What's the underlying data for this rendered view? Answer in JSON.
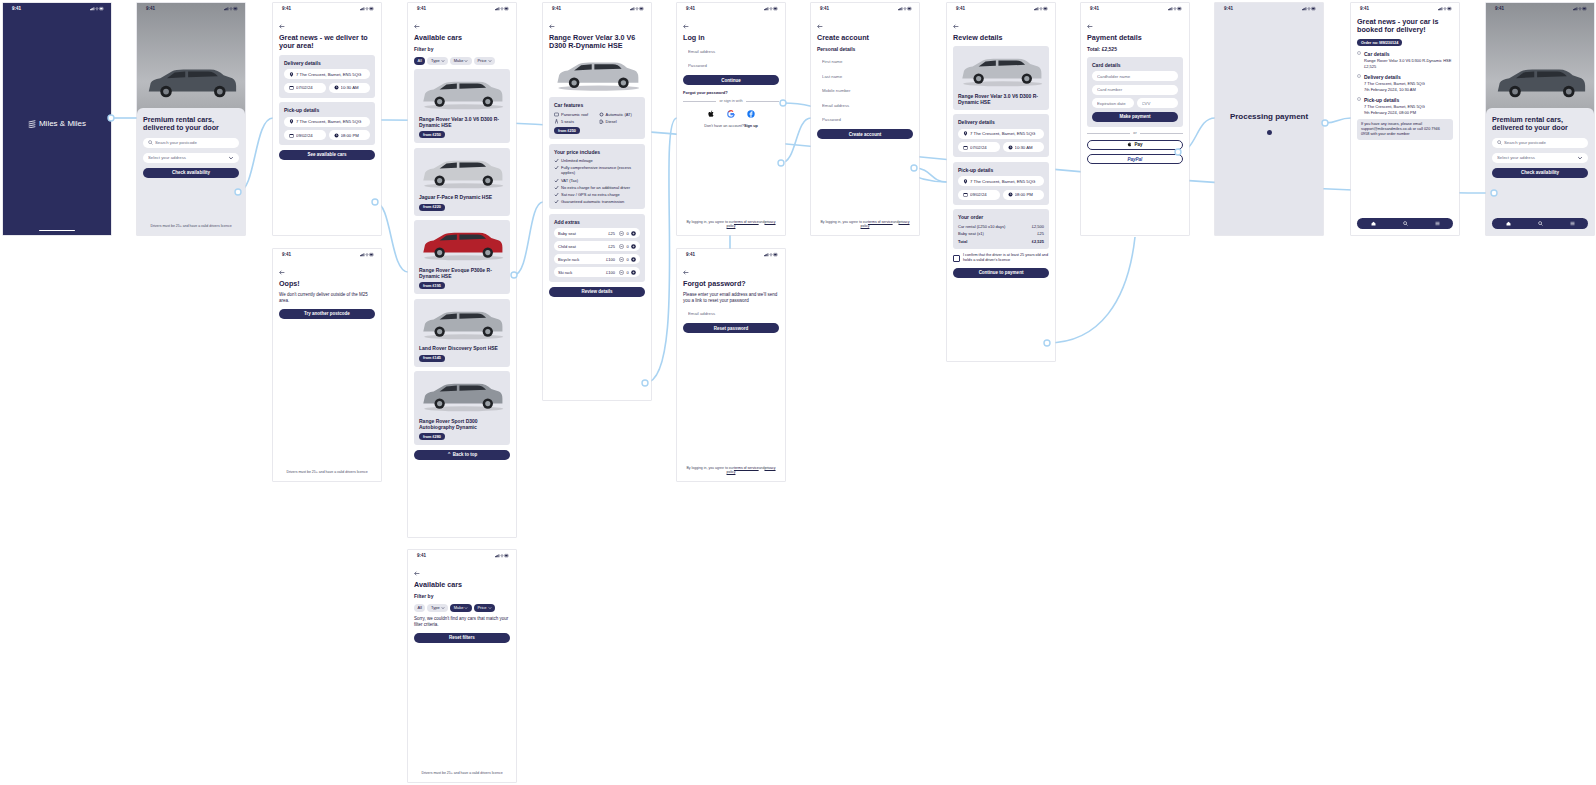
{
  "screens": [
    {
      "kind": "splash",
      "time": "9:41",
      "blocks": [
        {
          "kind": "logo",
          "text": "Miles & Miles"
        }
      ]
    },
    {
      "kind": "hero",
      "time": "9:41",
      "blocks": [
        {
          "kind": "photo"
        },
        {
          "kind": "sheet",
          "blocks": [
            {
              "kind": "title",
              "text": "Premium rental cars, delivered to your door"
            },
            {
              "kind": "field",
              "type": "search",
              "text": "Search your postcode"
            },
            {
              "kind": "field",
              "type": "select",
              "text": "Select your address"
            },
            {
              "kind": "button",
              "variant": "primary",
              "text": "Check availability"
            },
            {
              "kind": "spacer"
            },
            {
              "kind": "footnote",
              "text": "Drivers must be 25+ and have a valid drivers licence"
            }
          ]
        }
      ]
    },
    {
      "kind": "page",
      "time": "9:41",
      "blocks": [
        {
          "kind": "back"
        },
        {
          "kind": "title",
          "text": "Great news - we deliver to your area!"
        },
        {
          "kind": "card",
          "title": "Delivery details",
          "blocks": [
            {
              "kind": "field",
              "type": "address",
              "text": "7 The Crescent, Barnet, EN5 5QG"
            },
            {
              "kind": "fieldpair",
              "items": [
                {
                  "type": "date",
                  "text": "07/02/24"
                },
                {
                  "type": "time",
                  "text": "10:30 AM"
                }
              ]
            }
          ]
        },
        {
          "kind": "card",
          "title": "Pick-up details",
          "blocks": [
            {
              "kind": "field",
              "type": "address",
              "text": "7 The Crescent, Barnet, EN5 5QG"
            },
            {
              "kind": "fieldpair",
              "items": [
                {
                  "type": "date",
                  "text": "09/02/24"
                },
                {
                  "type": "time",
                  "text": "08:00 PM"
                }
              ]
            }
          ]
        },
        {
          "kind": "button",
          "variant": "primary",
          "text": "See available cars"
        }
      ]
    },
    {
      "kind": "page",
      "time": "9:41",
      "blocks": [
        {
          "kind": "back"
        },
        {
          "kind": "title",
          "text": "Oops!"
        },
        {
          "kind": "text",
          "text": "We don't currently deliver outside of the M25 area."
        },
        {
          "kind": "button",
          "variant": "primary",
          "text": "Try another postcode"
        },
        {
          "kind": "spacer"
        },
        {
          "kind": "footnote",
          "text": "Drivers must be 25+ and have a valid drivers licence"
        }
      ]
    },
    {
      "kind": "page",
      "time": "9:41",
      "blocks": [
        {
          "kind": "back"
        },
        {
          "kind": "title",
          "text": "Available cars"
        },
        {
          "kind": "heading",
          "text": "Filter by"
        },
        {
          "kind": "chips",
          "items": [
            {
              "text": "All",
              "selected": true,
              "dropdown": false
            },
            {
              "text": "Type",
              "selected": false,
              "dropdown": true
            },
            {
              "text": "Make",
              "selected": false,
              "dropdown": true
            },
            {
              "text": "Price",
              "selected": false,
              "dropdown": true
            }
          ]
        },
        {
          "kind": "card",
          "blocks": [
            {
              "kind": "carimage",
              "color": "#b9bcc2"
            },
            {
              "kind": "heading",
              "text": "Range Rover Velar 3.0 V6 D300 R-Dynamic HSE"
            },
            {
              "kind": "button",
              "variant": "badge",
              "text": "from £250"
            }
          ]
        },
        {
          "kind": "card",
          "blocks": [
            {
              "kind": "carimage",
              "color": "#c9cbcf"
            },
            {
              "kind": "heading",
              "text": "Jaguar F-Pace R Dynamic HSE"
            },
            {
              "kind": "button",
              "variant": "badge",
              "text": "from £220"
            }
          ]
        },
        {
          "kind": "card",
          "blocks": [
            {
              "kind": "carimage",
              "color": "#b3202a"
            },
            {
              "kind": "heading",
              "text": "Range Rover Evoque P300e R-Dynamic HSE"
            },
            {
              "kind": "button",
              "variant": "badge",
              "text": "from £195"
            }
          ]
        },
        {
          "kind": "card",
          "blocks": [
            {
              "kind": "carimage",
              "color": "#a9adb3"
            },
            {
              "kind": "heading",
              "text": "Land Rover Discovery Sport HSE"
            },
            {
              "kind": "button",
              "variant": "badge",
              "text": "from £145"
            }
          ]
        },
        {
          "kind": "card",
          "blocks": [
            {
              "kind": "carimage",
              "color": "#8f949b"
            },
            {
              "kind": "heading",
              "text": "Range Rover Sport D300 Autobiography Dynamic"
            },
            {
              "kind": "button",
              "variant": "badge",
              "text": "from £280"
            }
          ]
        },
        {
          "kind": "button",
          "variant": "primary",
          "icon": "⌃",
          "text": "Back to top"
        }
      ]
    },
    {
      "kind": "page",
      "time": "9:41",
      "blocks": [
        {
          "kind": "back"
        },
        {
          "kind": "title",
          "text": "Available cars"
        },
        {
          "kind": "heading",
          "text": "Filter by"
        },
        {
          "kind": "chips",
          "items": [
            {
              "text": "All",
              "selected": false,
              "dropdown": false
            },
            {
              "text": "Type",
              "selected": false,
              "dropdown": true
            },
            {
              "text": "Make",
              "selected": true,
              "dropdown": true
            },
            {
              "text": "Price",
              "selected": true,
              "dropdown": true
            }
          ]
        },
        {
          "kind": "text",
          "text": "Sorry, we couldn't find any cars that match your filter criteria."
        },
        {
          "kind": "button",
          "variant": "primary",
          "text": "Reset filters"
        },
        {
          "kind": "spacer"
        },
        {
          "kind": "footnote",
          "text": "Drivers must be 25+ and have a valid drivers licence"
        }
      ]
    },
    {
      "kind": "page",
      "time": "9:41",
      "blocks": [
        {
          "kind": "back"
        },
        {
          "kind": "title",
          "text": "Range Rover Velar 3.0 V6 D300 R-Dynamic HSE"
        },
        {
          "kind": "carimage",
          "color": "#b9bcc2"
        },
        {
          "kind": "card",
          "title": "Car features",
          "blocks": [
            {
              "kind": "features",
              "items": [
                "Panoramic roof",
                "Automatic (AT)",
                "5 seats",
                "Diesel"
              ]
            },
            {
              "kind": "button",
              "variant": "badge",
              "text": "from £250"
            }
          ]
        },
        {
          "kind": "card",
          "title": "Your price includes",
          "blocks": [
            {
              "kind": "checklist",
              "items": [
                "Unlimited mileage",
                "Fully comprehensive insurance (excess applies)",
                "VAT (Tax)",
                "No extra charge for an additional driver",
                "Sat nav / GPS at no extra charge",
                "Guaranteed automatic transmission"
              ]
            }
          ]
        },
        {
          "kind": "card",
          "title": "Add extras",
          "blocks": [
            {
              "kind": "extras",
              "items": [
                {
                  "name": "Baby seat",
                  "price": "£25",
                  "qty": "0"
                },
                {
                  "name": "Child seat",
                  "price": "£25",
                  "qty": "0"
                },
                {
                  "name": "Bicycle rack",
                  "price": "£100",
                  "qty": "0"
                },
                {
                  "name": "Ski rack",
                  "price": "£100",
                  "qty": "0"
                }
              ]
            }
          ]
        },
        {
          "kind": "button",
          "variant": "primary",
          "text": "Review details"
        }
      ]
    },
    {
      "kind": "page",
      "time": "9:41",
      "blocks": [
        {
          "kind": "back"
        },
        {
          "kind": "title",
          "text": "Log in"
        },
        {
          "kind": "field",
          "type": "plain",
          "text": "Email address"
        },
        {
          "kind": "field",
          "type": "plain",
          "text": "Password"
        },
        {
          "kind": "button",
          "variant": "primary",
          "text": "Continue"
        },
        {
          "kind": "link",
          "text": "Forgot your password?"
        },
        {
          "kind": "divider",
          "text": "or sign in with"
        },
        {
          "kind": "social"
        },
        {
          "kind": "textlink",
          "text": "Don't have an account?",
          "link": "Sign up"
        },
        {
          "kind": "spacer"
        },
        {
          "kind": "legal",
          "parts": [
            "By logging in, you agree to our",
            "terms of service",
            "and",
            "privacy policy"
          ]
        }
      ]
    },
    {
      "kind": "page",
      "time": "9:41",
      "blocks": [
        {
          "kind": "back"
        },
        {
          "kind": "title",
          "text": "Forgot password?"
        },
        {
          "kind": "text",
          "text": "Please enter your email address and we'll send you a link to reset your password"
        },
        {
          "kind": "field",
          "type": "plain",
          "text": "Email address"
        },
        {
          "kind": "button",
          "variant": "primary",
          "text": "Reset password"
        },
        {
          "kind": "spacer"
        },
        {
          "kind": "legal",
          "parts": [
            "By logging in, you agree to our",
            "terms of service",
            "and",
            "privacy policy"
          ]
        }
      ]
    },
    {
      "kind": "page",
      "time": "9:41",
      "blocks": [
        {
          "kind": "back"
        },
        {
          "kind": "title",
          "text": "Create account"
        },
        {
          "kind": "heading",
          "text": "Personal details"
        },
        {
          "kind": "field",
          "type": "plain",
          "text": "First name"
        },
        {
          "kind": "field",
          "type": "plain",
          "text": "Last name"
        },
        {
          "kind": "field",
          "type": "plain",
          "text": "Mobile number"
        },
        {
          "kind": "field",
          "type": "plain",
          "text": "Email address"
        },
        {
          "kind": "field",
          "type": "plain",
          "text": "Password"
        },
        {
          "kind": "button",
          "variant": "primary",
          "text": "Create account"
        },
        {
          "kind": "spacer"
        },
        {
          "kind": "legal",
          "parts": [
            "By logging in, you agree to our",
            "terms of service",
            "and",
            "privacy policy"
          ]
        }
      ]
    },
    {
      "kind": "page",
      "time": "9:41",
      "blocks": [
        {
          "kind": "back"
        },
        {
          "kind": "title",
          "text": "Review details"
        },
        {
          "kind": "card",
          "blocks": [
            {
              "kind": "carimage",
              "color": "#b9bcc2"
            },
            {
              "kind": "heading",
              "text": "Range Rover Velar 3.0 V6 D300 R-Dynamic HSE"
            }
          ]
        },
        {
          "kind": "card",
          "title": "Delivery details",
          "blocks": [
            {
              "kind": "field",
              "type": "address",
              "text": "7 The Crescent, Barnet, EN5 5QG"
            },
            {
              "kind": "fieldpair",
              "items": [
                {
                  "type": "date",
                  "text": "07/02/24"
                },
                {
                  "type": "time",
                  "text": "10:30 AM"
                }
              ]
            }
          ]
        },
        {
          "kind": "card",
          "title": "Pick-up details",
          "blocks": [
            {
              "kind": "field",
              "type": "address",
              "text": "7 The Crescent, Barnet, EN5 5QG"
            },
            {
              "kind": "fieldpair",
              "items": [
                {
                  "type": "date",
                  "text": "09/02/24"
                },
                {
                  "type": "time",
                  "text": "08:00 PM"
                }
              ]
            }
          ]
        },
        {
          "kind": "card",
          "title": "Your order",
          "blocks": [
            {
              "kind": "summary",
              "rows": [
                {
                  "label": "Car rental (£250 x10 days)",
                  "value": "£2,500",
                  "bold": false
                },
                {
                  "label": "Baby seat (x1)",
                  "value": "£25",
                  "bold": false
                },
                {
                  "label": "Total",
                  "value": "£2,525",
                  "bold": true
                }
              ]
            }
          ]
        },
        {
          "kind": "checkbox",
          "checked": false,
          "text": "I confirm that the driver is at least 25 years old and holds a valid driver's licence"
        },
        {
          "kind": "button",
          "variant": "primary",
          "text": "Continue to payment"
        }
      ]
    },
    {
      "kind": "page",
      "time": "9:41",
      "blocks": [
        {
          "kind": "back"
        },
        {
          "kind": "title",
          "text": "Payment details"
        },
        {
          "kind": "heading",
          "text": "Total: £2,525"
        },
        {
          "kind": "card",
          "title": "Card details",
          "blocks": [
            {
              "kind": "field",
              "type": "plain",
              "text": "Cardholder name"
            },
            {
              "kind": "field",
              "type": "plain",
              "text": "Card number"
            },
            {
              "kind": "fieldpair",
              "items": [
                {
                  "type": "plain",
                  "text": "Expiration date"
                },
                {
                  "type": "plain",
                  "text": "CVV"
                }
              ]
            },
            {
              "kind": "button",
              "variant": "primary",
              "text": "Make payment"
            }
          ]
        },
        {
          "kind": "divider",
          "text": "or"
        },
        {
          "kind": "button",
          "variant": "applepay",
          "text": "Pay"
        },
        {
          "kind": "button",
          "variant": "paypal",
          "text": "PayPal"
        }
      ]
    },
    {
      "kind": "center",
      "time": "9:41",
      "blocks": [
        {
          "kind": "title",
          "text": "Processing payment"
        },
        {
          "kind": "dot"
        }
      ]
    },
    {
      "kind": "page",
      "time": "9:41",
      "blocks": [
        {
          "kind": "title",
          "text": "Great news - your car is booked for delivery!"
        },
        {
          "kind": "button",
          "variant": "badge",
          "text": "Order no: MM230124"
        },
        {
          "kind": "steps",
          "items": [
            {
              "title": "Car details",
              "lines": [
                "Range Rover Velar 3.0 V6 D300 R-Dynamic HSE",
                "£2,525"
              ]
            },
            {
              "title": "Delivery details",
              "lines": [
                "7 The Crescent, Barnet, EN5 5QG",
                "7th February 2024, 10:30 AM"
              ]
            },
            {
              "title": "Pick-up details",
              "lines": [
                "7 The Crescent, Barnet, EN5 5QG",
                "9th February 2024, 08:00 PM"
              ]
            }
          ]
        },
        {
          "kind": "info",
          "text": "If you have any issues, please email support@milesandmiles.co.uk or call 020 7946 0958 with your order number"
        },
        {
          "kind": "spacer"
        },
        {
          "kind": "navbar"
        }
      ]
    },
    {
      "kind": "hero",
      "time": "9:41",
      "blocks": [
        {
          "kind": "photo"
        },
        {
          "kind": "sheet",
          "blocks": [
            {
              "kind": "title",
              "text": "Premium rental cars, delivered to your door"
            },
            {
              "kind": "field",
              "type": "search",
              "text": "Search your postcode"
            },
            {
              "kind": "field",
              "type": "select",
              "text": "Select your address"
            },
            {
              "kind": "button",
              "variant": "primary",
              "text": "Check availability"
            },
            {
              "kind": "spacer"
            },
            {
              "kind": "navbar"
            }
          ]
        }
      ]
    }
  ]
}
